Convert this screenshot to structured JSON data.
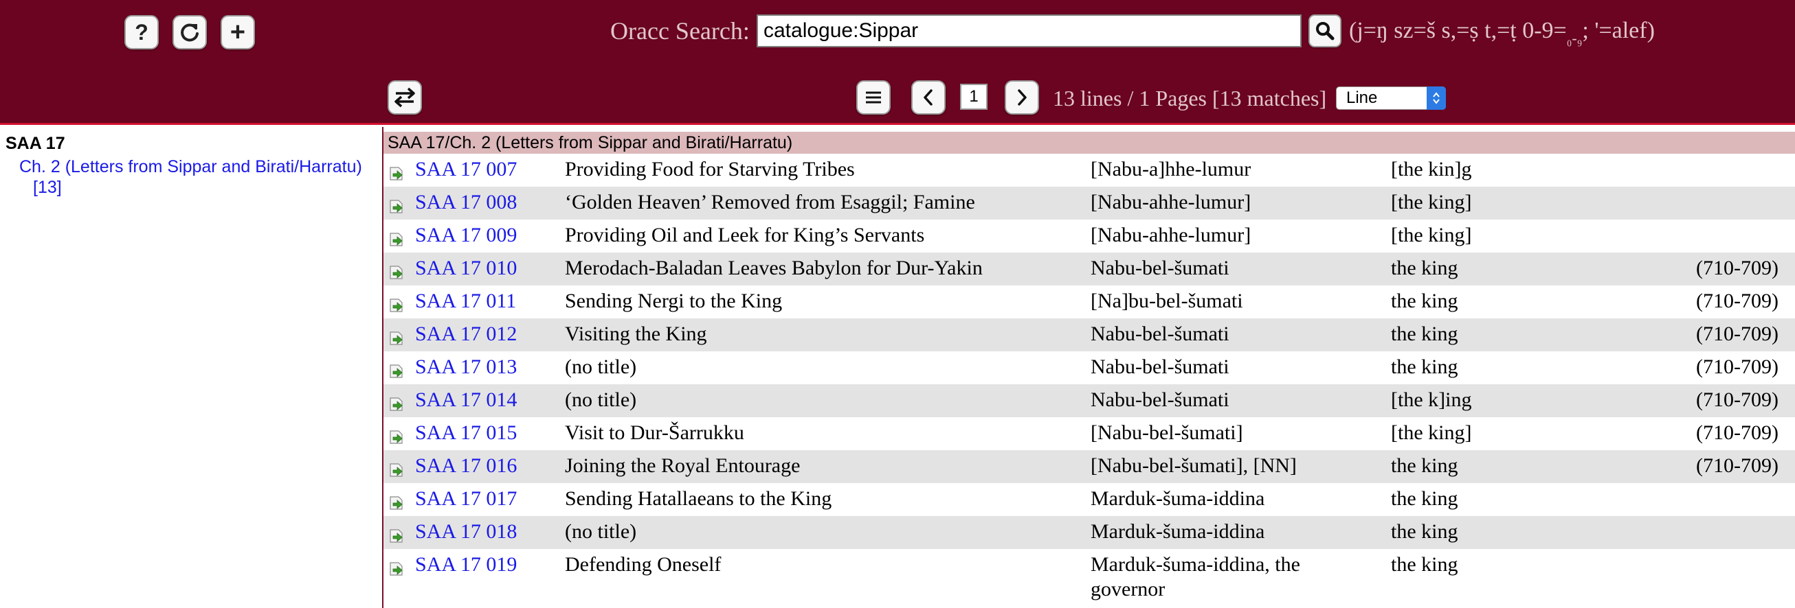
{
  "header": {
    "buttons": {
      "help_symbol": "?",
      "plus_symbol": "+"
    },
    "search": {
      "label": "Oracc Search:",
      "value": "catalogue:Sippar",
      "hint": "(j=ŋ sz=š s,=ṣ t,=ṭ 0-9=",
      "hint_subscript": "₀-₉",
      "hint_end": "; '=alef)"
    },
    "pager": {
      "current_page": "1",
      "info": "13 lines / 1 Pages [13 matches]",
      "view_mode": "Line"
    }
  },
  "sidebar": {
    "title": "SAA 17",
    "chapter_link": "Ch. 2 (Letters from Sippar and Birati/Harratu)",
    "count": "[13]"
  },
  "results": {
    "group_header": "SAA 17/Ch. 2 (Letters from Sippar and Birati/Harratu)",
    "rows": [
      {
        "id": "SAA 17 007",
        "title": "Providing Food for Starving Tribes",
        "author": "[Nabu-a]hhe-lumur",
        "recipient": "[the kin]g",
        "date": ""
      },
      {
        "id": "SAA 17 008",
        "title": "‘Golden Heaven’ Removed from Esaggil; Famine",
        "author": "[Nabu-ahhe-lumur]",
        "recipient": "[the king]",
        "date": ""
      },
      {
        "id": "SAA 17 009",
        "title": "Providing Oil and Leek for King’s Servants",
        "author": "[Nabu-ahhe-lumur]",
        "recipient": "[the king]",
        "date": ""
      },
      {
        "id": "SAA 17 010",
        "title": "Merodach-Baladan Leaves Babylon for Dur-Yakin",
        "author": "Nabu-bel-šumati",
        "recipient": "the king",
        "date": "(710-709)"
      },
      {
        "id": "SAA 17 011",
        "title": "Sending Nergi to the King",
        "author": "[Na]bu-bel-šumati",
        "recipient": "the king",
        "date": "(710-709)"
      },
      {
        "id": "SAA 17 012",
        "title": "Visiting the King",
        "author": "Nabu-bel-šumati",
        "recipient": "the king",
        "date": "(710-709)"
      },
      {
        "id": "SAA 17 013",
        "title": "(no title)",
        "author": "Nabu-bel-šumati",
        "recipient": "the king",
        "date": "(710-709)"
      },
      {
        "id": "SAA 17 014",
        "title": "(no title)",
        "author": "Nabu-bel-šumati",
        "recipient": "[the k]ing",
        "date": "(710-709)"
      },
      {
        "id": "SAA 17 015",
        "title": "Visit to Dur-Šarrukku",
        "author": "[Nabu-bel-šumati]",
        "recipient": "[the king]",
        "date": "(710-709)"
      },
      {
        "id": "SAA 17 016",
        "title": "Joining the Royal Entourage",
        "author": "[Nabu-bel-šumati], [NN]",
        "recipient": "the king",
        "date": "(710-709)"
      },
      {
        "id": "SAA 17 017",
        "title": "Sending Hatallaeans to the King",
        "author": "Marduk-šuma-iddina",
        "recipient": "the king",
        "date": ""
      },
      {
        "id": "SAA 17 018",
        "title": "(no title)",
        "author": "Marduk-šuma-iddina",
        "recipient": "the king",
        "date": ""
      },
      {
        "id": "SAA 17 019",
        "title": "Defending Oneself",
        "author": "Marduk-šuma-iddina, the governor",
        "recipient": "the king",
        "date": ""
      }
    ]
  },
  "icons": {
    "help": "help-icon",
    "reload": "reload-icon",
    "add": "add-icon",
    "swap": "swap-arrows-icon",
    "search": "magnifier-icon",
    "menu": "menu-lines-icon",
    "prev": "chevron-left-icon",
    "next": "chevron-right-icon",
    "open_text": "open-text-arrow-icon"
  },
  "colors": {
    "header_bg": "#6a0420",
    "header_accent": "#d01030",
    "link": "#1a1ae6",
    "group_header_bg": "#dcb8bb",
    "row_alt_bg": "#e3e3e3",
    "icon_green": "#3a9a2a"
  }
}
